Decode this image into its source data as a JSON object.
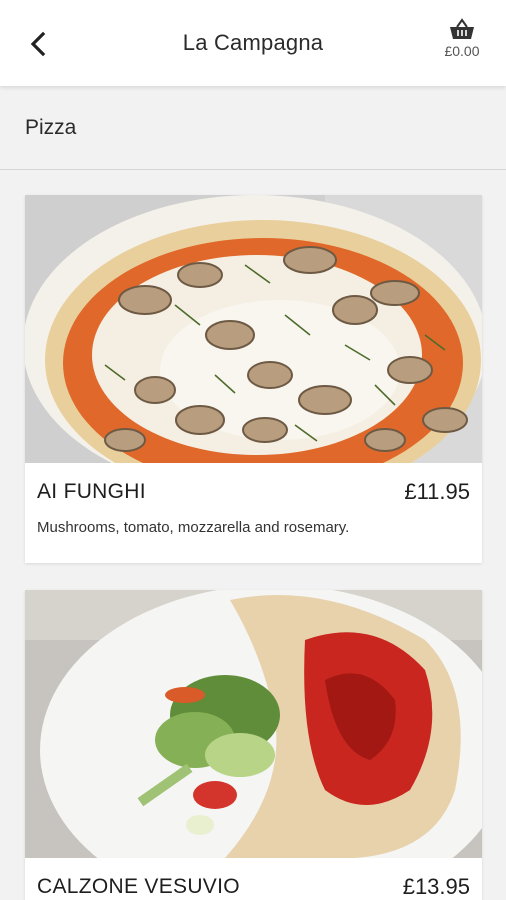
{
  "header": {
    "title": "La Campagna",
    "back_icon": "chevron-left-icon",
    "basket_icon": "basket-icon",
    "basket_total": "£0.00"
  },
  "category": {
    "title": "Pizza"
  },
  "items": [
    {
      "name": "AI FUNGHI",
      "price": "£11.95",
      "description": "Mushrooms, tomato, mozzarella and rosemary.",
      "image": "pizza-photo"
    },
    {
      "name": "CALZONE VESUVIO",
      "price": "£13.95",
      "description": "",
      "image": "calzone-photo"
    }
  ],
  "colors": {
    "header_bg": "#ffffff",
    "page_bg": "#f2f2f2",
    "text": "#222222"
  }
}
